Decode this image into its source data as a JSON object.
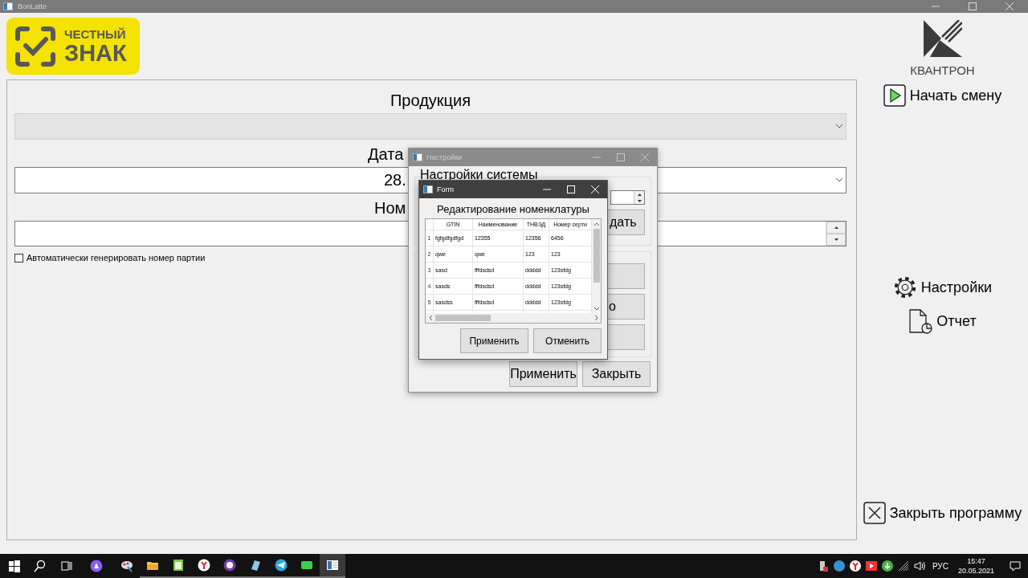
{
  "main_window": {
    "title": "BonLatte",
    "logo": {
      "line1": "ЧЕСТНЫЙ",
      "line2": "ЗНАК"
    },
    "brand": "КВАНТРОН",
    "fields": [
      {
        "kind": "combo",
        "label": "Продукция",
        "disabled": true
      },
      {
        "kind": "combo",
        "label": "Дата",
        "value": "28.",
        "disabled": false
      },
      {
        "kind": "spin",
        "label": "Ном",
        "disabled": false
      }
    ],
    "auto_number": {
      "label": "Автоматически генерировать номер партии",
      "checked": false
    },
    "actions": [
      {
        "kind": "start",
        "label": "Начать смену"
      },
      {
        "kind": "settings",
        "label": "Настройки"
      },
      {
        "kind": "report",
        "label": "Отчет"
      },
      {
        "kind": "exit",
        "label": "Закрыть программу"
      }
    ]
  },
  "settings_dialog": {
    "title": "Настройки",
    "group_title": "Настройки системы",
    "group_button": "дать",
    "partial_button_label": "о",
    "buttons": [
      "Применить",
      "Закрыть"
    ]
  },
  "form_dialog": {
    "title": "Form",
    "heading": "Редактирование номенклатуры",
    "table": {
      "columns": [
        "GTIN",
        "Наименование",
        "ТНВЭД",
        "Номер серти"
      ],
      "rows": [
        {
          "index": "1",
          "cells": [
            "fgfgdfgdfgd",
            "12355",
            "12356",
            "6456"
          ]
        },
        {
          "index": "2",
          "cells": [
            "qwe",
            "qwe",
            "123",
            "123"
          ]
        },
        {
          "index": "3",
          "cells": [
            "sasd",
            "fffdsdsd",
            "ddddd",
            "123sfdg"
          ]
        },
        {
          "index": "4",
          "cells": [
            "sasds",
            "fffdsdsd",
            "ddddd",
            "123sfdg"
          ]
        },
        {
          "index": "5",
          "cells": [
            "sasdss",
            "fffdsdsd",
            "ddddd",
            "123sfdg"
          ]
        }
      ]
    },
    "buttons": [
      "Применить",
      "Отменить"
    ]
  },
  "taskbar": {
    "language": "РУС",
    "time": "15:47",
    "date": "20.05.2021"
  }
}
